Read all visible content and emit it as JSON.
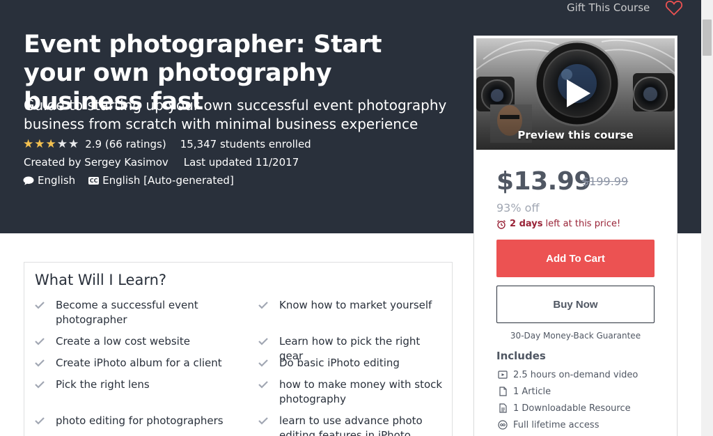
{
  "header": {
    "gift_label": "Gift This Course"
  },
  "course": {
    "title": "Event photographer: Start your own photography business fast",
    "subtitle": "Guide to starting up your own successful event photography business from scratch with minimal business experience",
    "rating_value": 2.9,
    "rating_text": "2.9 (66 ratings)",
    "students": "15,347 students enrolled",
    "created_by": "Created by Sergey Kasimov",
    "last_updated": "Last updated 11/2017",
    "language": "English",
    "captions": "English [Auto-generated]"
  },
  "sidebar": {
    "preview_label": "Preview this course",
    "price": "$13.99",
    "original_price": "$199.99",
    "discount": "93% off",
    "timer_bold": "2 days",
    "timer_rest": "left at this price!",
    "add_to_cart": "Add To Cart",
    "buy_now": "Buy Now",
    "guarantee": "30-Day Money-Back Guarantee",
    "includes_title": "Includes",
    "includes": [
      {
        "icon": "video-icon",
        "label": "2.5 hours on-demand video"
      },
      {
        "icon": "article-icon",
        "label": "1 Article"
      },
      {
        "icon": "download-icon",
        "label": "1 Downloadable Resource"
      },
      {
        "icon": "infinity-icon",
        "label": "Full lifetime access"
      }
    ]
  },
  "learn": {
    "title": "What Will I Learn?",
    "items": [
      "Become a successful event photographer",
      "Know how to market yourself",
      "Create a low cost website",
      "Learn how to pick the right gear",
      "Create iPhoto album for a client",
      "Do basic iPhoto editing",
      "Pick the right lens",
      "how to make money with stock photography",
      "photo editing for photographers",
      "learn to use advance photo editing features in iPhoto"
    ]
  },
  "colors": {
    "hero_bg": "#29303b",
    "accent_red": "#ec5252",
    "star": "#f4c150"
  }
}
